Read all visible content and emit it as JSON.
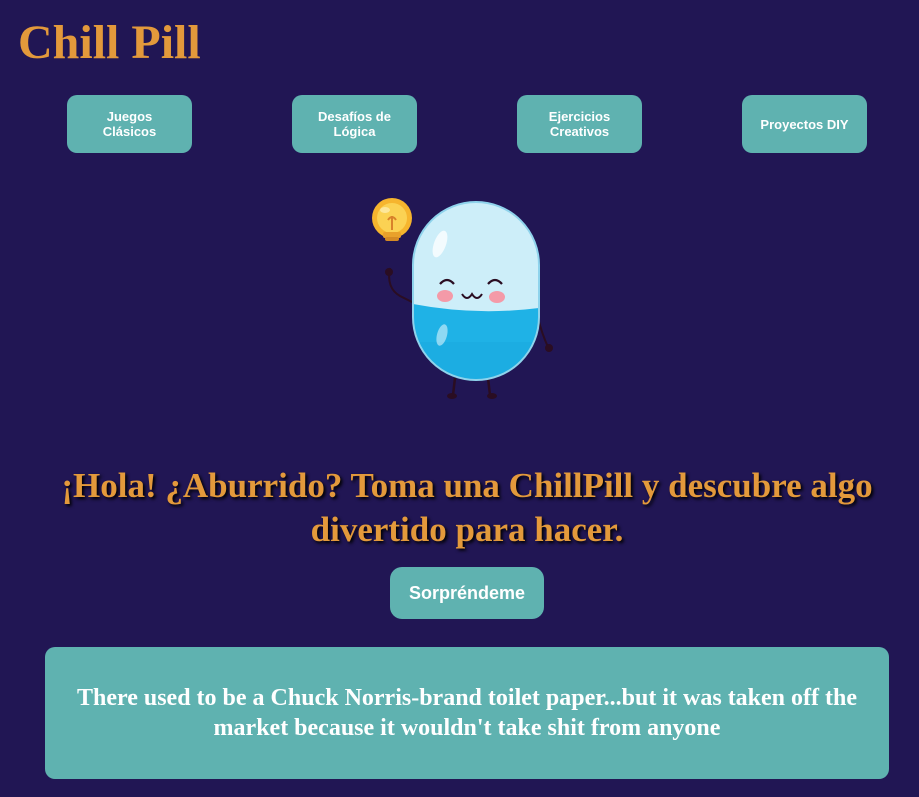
{
  "header": {
    "brand": "Chill Pill"
  },
  "nav": {
    "items": [
      {
        "label": "Juegos Clásicos"
      },
      {
        "label": "Desafíos de Lógica"
      },
      {
        "label": "Ejercicios Creativos"
      },
      {
        "label": "Proyectos DIY"
      }
    ]
  },
  "hero": {
    "mascot_icon": "pill-mascot-with-lightbulb",
    "headline": "¡Hola! ¿Aburrido? Toma una ChillPill y descubre algo divertido para hacer.",
    "button_label": "Sorpréndeme"
  },
  "joke": {
    "text": "There used to be a Chuck Norris-brand toilet paper...but it was taken off the market because it wouldn't take shit from anyone"
  },
  "colors": {
    "background": "#211654",
    "accent": "#e3993b",
    "button": "#5fb2b0",
    "text_light": "#ffffff"
  }
}
